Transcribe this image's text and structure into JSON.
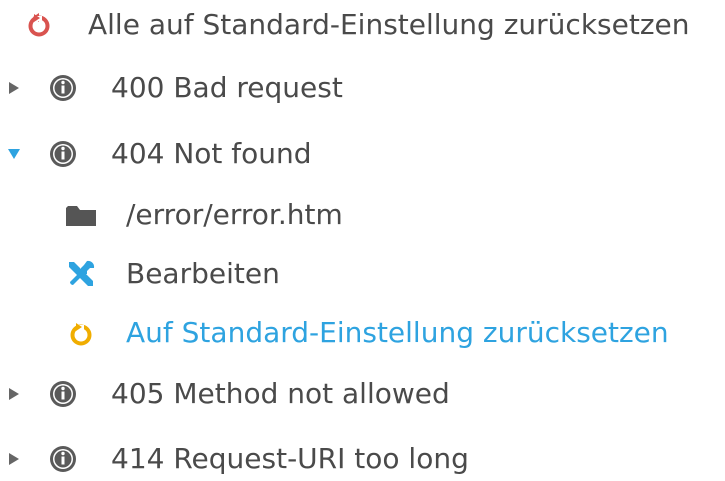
{
  "reset_all": {
    "label": "Alle auf Standard-Einstellung zurücksetzen",
    "icon": "reset-icon",
    "icon_color": "#d9534f"
  },
  "items": [
    {
      "label": "400 Bad request",
      "expanded": false
    },
    {
      "label": "404 Not found",
      "expanded": true,
      "children": {
        "path": "/error/error.htm",
        "edit_label": "Bearbeiten",
        "reset_label": "Auf Standard-Einstellung zurücksetzen"
      }
    },
    {
      "label": "405 Method not allowed",
      "expanded": false
    },
    {
      "label": "414 Request-URI too long",
      "expanded": false
    }
  ],
  "colors": {
    "text": "#4a4a4a",
    "link": "#2ea3e0",
    "expanded_arrow": "#2ea3e0",
    "collapsed_arrow": "#666666",
    "info_icon": "#5a5a5a",
    "folder_icon": "#555555",
    "edit_icon": "#2ea3e0",
    "reset_child_icon": "#f0ad00"
  }
}
